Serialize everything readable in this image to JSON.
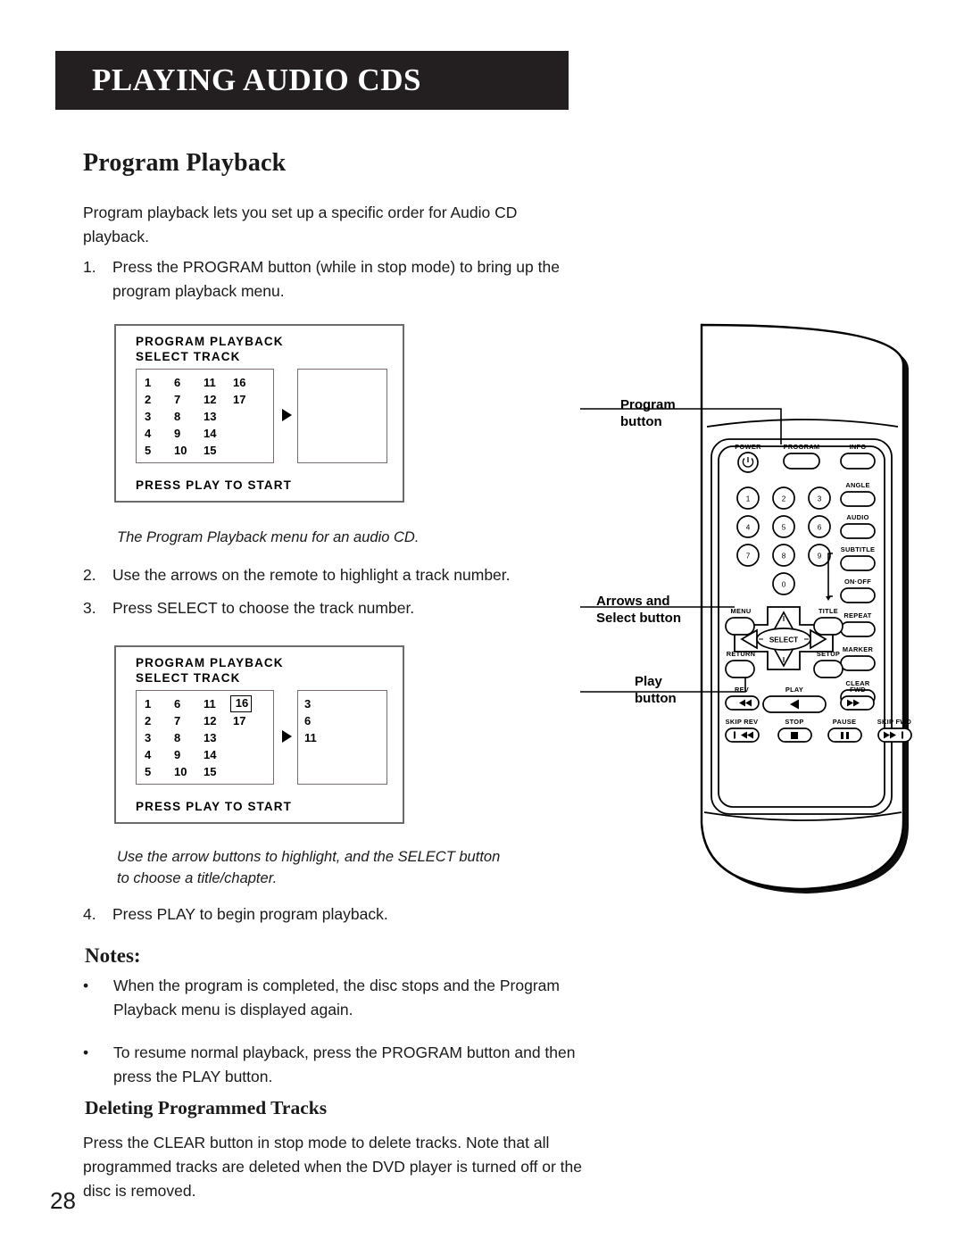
{
  "header": {
    "title": "PLAYING AUDIO CDS"
  },
  "section": {
    "heading": "Program Playback",
    "intro": "Program playback lets you set up a specific order for Audio CD playback.",
    "steps": [
      {
        "number": "1.",
        "text": "Press the PROGRAM button (while in stop mode) to bring up the program playback menu."
      },
      {
        "number": "2.",
        "text": "Use the arrows on the remote to highlight a track number."
      },
      {
        "number": "3.",
        "text": "Press SELECT to choose the track number."
      },
      {
        "number": "4.",
        "text": "Press PLAY to begin program playback."
      }
    ],
    "caption_1": "The Program Playback menu for an audio CD.",
    "caption_2": "Use the arrow buttons to highlight, and the SELECT button to choose a title/chapter."
  },
  "osd_menu_1": {
    "title_line1": "PROGRAM PLAYBACK",
    "title_line2": "SELECT TRACK",
    "footer": "PRESS PLAY TO START",
    "tracks": [
      "1",
      "6",
      "11",
      "16",
      "2",
      "7",
      "12",
      "17",
      "3",
      "8",
      "13",
      "",
      "4",
      "9",
      "14",
      "",
      "5",
      "10",
      "15",
      ""
    ],
    "highlighted_track": "",
    "program_list": []
  },
  "osd_menu_2": {
    "title_line1": "PROGRAM PLAYBACK",
    "title_line2": "SELECT TRACK",
    "footer": "PRESS PLAY TO START",
    "tracks": [
      "1",
      "6",
      "11",
      "16",
      "2",
      "7",
      "12",
      "17",
      "3",
      "8",
      "13",
      "",
      "4",
      "9",
      "14",
      "",
      "5",
      "10",
      "15",
      ""
    ],
    "highlighted_track": "16",
    "program_list": [
      "3",
      "6",
      "11"
    ]
  },
  "notes": {
    "heading": "Notes:",
    "items": [
      "When the program is completed, the disc stops and the Program Playback menu is displayed again.",
      "To resume normal playback, press the PROGRAM button and then press the PLAY button."
    ],
    "bullet_char": "•"
  },
  "deleting": {
    "heading": "Deleting Programmed Tracks",
    "text": "Press the CLEAR button in stop mode to delete tracks.  Note that all programmed tracks are deleted when the DVD player is turned off or the disc is removed."
  },
  "page_number": "28",
  "remote": {
    "callouts": {
      "program": "Program\nbutton",
      "program_l1": "Program",
      "program_l2": "button",
      "arrows_l1": "Arrows and",
      "arrows_l2": "Select button",
      "play_l1": "Play",
      "play_l2": "button"
    },
    "buttons": {
      "power": "POWER",
      "program": "PROGRAM",
      "info": "INFO",
      "angle": "ANGLE",
      "audio": "AUDIO",
      "subtitle": "SUBTITLE",
      "onoff": "ON·OFF",
      "repeat": "REPEAT",
      "marker": "MARKER",
      "clear": "CLEAR",
      "menu": "MENU",
      "title": "TITLE",
      "return": "RETURN",
      "setup": "SETUP",
      "select": "SELECT",
      "rev": "REV",
      "play": "PLAY",
      "fwd": "FWD",
      "skip_rev": "SKIP REV",
      "stop": "STOP",
      "pause": "PAUSE",
      "skip_fwd": "SKIP FWD"
    },
    "keypad": [
      "1",
      "2",
      "3",
      "4",
      "5",
      "6",
      "7",
      "8",
      "9",
      "0"
    ]
  },
  "colors": {
    "banner_bg": "#231f20",
    "banner_text": "#ffffff",
    "body_text": "#1a1a1a",
    "osd_border": "#6b6b6b"
  }
}
